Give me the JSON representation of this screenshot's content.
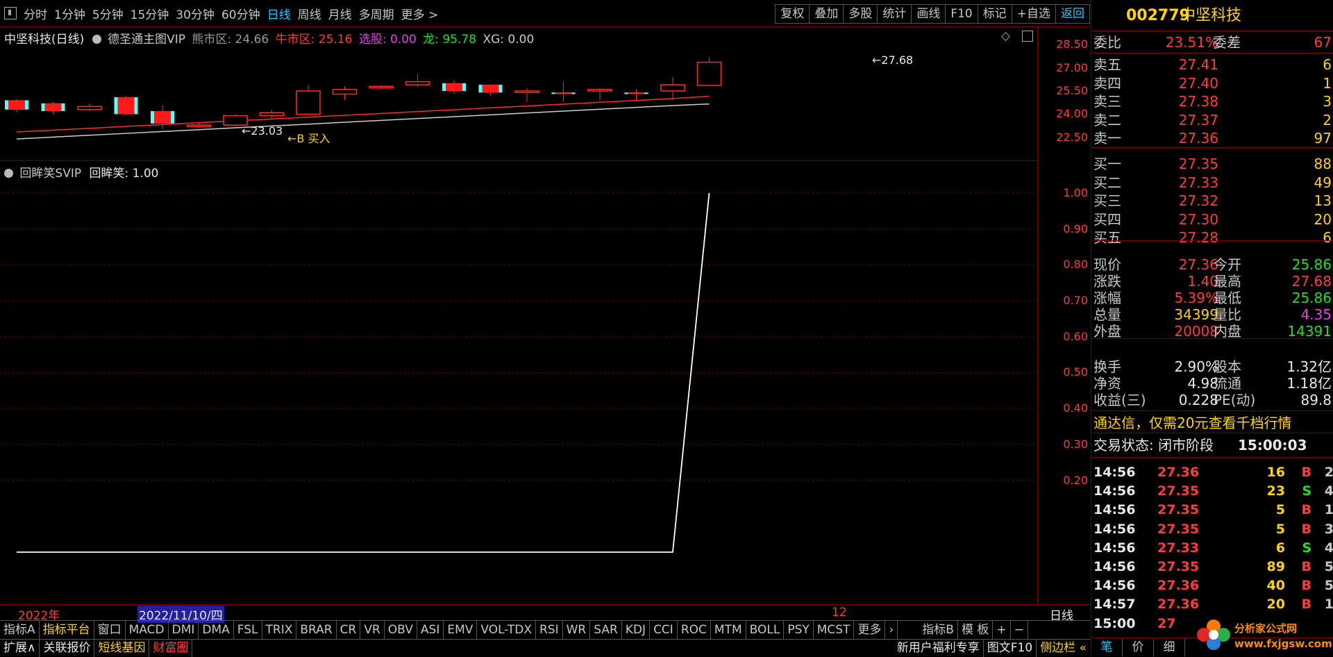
{
  "toolbar": {
    "periods": [
      "分时",
      "1分钟",
      "5分钟",
      "15分钟",
      "30分钟",
      "60分钟",
      "日线",
      "周线",
      "月线",
      "多周期",
      "更多 >"
    ],
    "active_period": "日线",
    "tools": [
      "复权",
      "叠加",
      "多股",
      "统计",
      "画线",
      "F10",
      "标记",
      "+自选",
      "返回"
    ]
  },
  "main_chart": {
    "stock_label": "中坚科技(日线)",
    "indicator_name": "德圣通主图VIP",
    "bear_label": "熊市区:",
    "bear_value": "24.66",
    "bull_label": "牛市区:",
    "bull_value": "25.16",
    "pick_label": "选股:",
    "pick_value": "0.00",
    "dragon_label": "龙:",
    "dragon_value": "95.78",
    "xg_label": "XG:",
    "xg_value": "0.00",
    "high_marker": "←27.68",
    "low_marker": "←23.03",
    "buy_marker": "←B 买入",
    "axis_ticks": [
      "28.50",
      "27.00",
      "25.50",
      "24.00",
      "22.50"
    ]
  },
  "chart_data": [
    {
      "type": "candlestick",
      "title": "中坚科技(日线)",
      "ylim": [
        22.0,
        29.0
      ],
      "candles": [
        {
          "open": 24.9,
          "close": 24.3,
          "high": 25.0,
          "low": 24.1,
          "color": "cyan"
        },
        {
          "open": 24.7,
          "close": 24.2,
          "high": 24.8,
          "low": 24.0,
          "color": "cyan"
        },
        {
          "open": 24.3,
          "close": 24.5,
          "high": 24.7,
          "low": 24.2,
          "color": "red"
        },
        {
          "open": 25.1,
          "close": 24.0,
          "high": 25.2,
          "low": 23.9,
          "color": "cyan"
        },
        {
          "open": 24.2,
          "close": 23.4,
          "high": 24.6,
          "low": 23.03,
          "color": "cyan"
        },
        {
          "open": 23.2,
          "close": 23.3,
          "high": 23.4,
          "low": 23.1,
          "color": "red"
        },
        {
          "open": 23.3,
          "close": 23.9,
          "high": 24.0,
          "low": 23.2,
          "color": "red"
        },
        {
          "open": 23.9,
          "close": 24.1,
          "high": 24.3,
          "low": 23.7,
          "color": "red"
        },
        {
          "open": 24.0,
          "close": 25.5,
          "high": 25.9,
          "low": 23.9,
          "color": "red"
        },
        {
          "open": 25.3,
          "close": 25.6,
          "high": 25.8,
          "low": 24.9,
          "color": "red"
        },
        {
          "open": 25.7,
          "close": 25.8,
          "high": 25.9,
          "low": 25.6,
          "color": "red"
        },
        {
          "open": 25.9,
          "close": 26.1,
          "high": 26.6,
          "low": 25.8,
          "color": "red"
        },
        {
          "open": 26.0,
          "close": 25.5,
          "high": 26.2,
          "low": 25.3,
          "color": "cyan"
        },
        {
          "open": 25.9,
          "close": 25.4,
          "high": 25.9,
          "low": 25.2,
          "color": "cyan"
        },
        {
          "open": 25.4,
          "close": 25.5,
          "high": 25.7,
          "low": 24.8,
          "color": "red"
        },
        {
          "open": 25.4,
          "close": 25.3,
          "high": 26.1,
          "low": 24.8,
          "color": "cyan"
        },
        {
          "open": 25.5,
          "close": 25.6,
          "high": 25.7,
          "low": 24.9,
          "color": "red"
        },
        {
          "open": 25.3,
          "close": 25.4,
          "high": 25.6,
          "low": 24.9,
          "color": "cyan"
        },
        {
          "open": 25.5,
          "close": 25.9,
          "high": 26.4,
          "low": 24.9,
          "color": "red"
        },
        {
          "open": 25.86,
          "close": 27.36,
          "high": 27.68,
          "low": 25.86,
          "color": "red"
        }
      ],
      "series": [
        {
          "values": [
            22.4,
            22.52,
            22.64,
            22.76,
            22.88,
            23.0,
            23.12,
            23.24,
            23.36,
            23.48,
            23.6,
            23.72,
            23.84,
            23.96,
            24.08,
            24.2,
            24.32,
            24.44,
            24.56,
            24.66
          ],
          "color": "white"
        },
        {
          "values": [
            22.85,
            22.97,
            23.09,
            23.21,
            23.33,
            23.45,
            23.57,
            23.69,
            23.81,
            23.93,
            24.05,
            24.17,
            24.29,
            24.41,
            24.53,
            24.65,
            24.77,
            24.89,
            25.01,
            25.16
          ],
          "color": "red"
        }
      ]
    },
    {
      "type": "line",
      "title": "回眸笑SVIP",
      "ylim": [
        0.0,
        1.05
      ],
      "y_ticks": [
        "1.00",
        "0.90",
        "0.80",
        "0.70",
        "0.60",
        "0.50",
        "0.40",
        "0.30",
        "0.20"
      ],
      "series": [
        {
          "name": "回眸笑",
          "values": [
            0,
            0,
            0,
            0,
            0,
            0,
            0,
            0,
            0,
            0,
            0,
            0,
            0,
            0,
            0,
            0,
            0,
            0,
            0,
            1.0
          ]
        }
      ]
    }
  ],
  "sub_chart": {
    "indicator_name": "回眸笑SVIP",
    "value_label": "回眸笑:",
    "value": "1.00"
  },
  "datebar": {
    "year": "2022年",
    "cursor_date": "2022/11/10/四",
    "month": "12",
    "period": "日线"
  },
  "indicator_tabs": [
    "指标A",
    "指标平台",
    "窗口",
    "MACD",
    "DMI",
    "DMA",
    "FSL",
    "TRIX",
    "BRAR",
    "CR",
    "VR",
    "OBV",
    "ASI",
    "EMV",
    "VOL-TDX",
    "RSI",
    "WR",
    "SAR",
    "KDJ",
    "CCI",
    "ROC",
    "MTM",
    "BOLL",
    "PSY",
    "MCST",
    "更多",
    "›",
    "指标B",
    "模 板",
    "+",
    "−"
  ],
  "status_bar": {
    "items": [
      "扩展∧",
      "关联报价",
      "短线基因",
      "财富圈"
    ],
    "right": [
      "新用户福利专享",
      "图文F10",
      "侧边栏 «"
    ]
  },
  "quote": {
    "code": "002779",
    "name": "中坚科技",
    "weibi_label": "委比",
    "weibi": "23.51%",
    "weicha_label": "委差",
    "weicha": "67",
    "asks": [
      {
        "label": "卖五",
        "price": "27.41",
        "vol": "6"
      },
      {
        "label": "卖四",
        "price": "27.40",
        "vol": "1"
      },
      {
        "label": "卖三",
        "price": "27.38",
        "vol": "3"
      },
      {
        "label": "卖二",
        "price": "27.37",
        "vol": "2"
      },
      {
        "label": "卖一",
        "price": "27.36",
        "vol": "97"
      }
    ],
    "bids": [
      {
        "label": "买一",
        "price": "27.35",
        "vol": "88"
      },
      {
        "label": "买二",
        "price": "27.33",
        "vol": "49"
      },
      {
        "label": "买三",
        "price": "27.32",
        "vol": "13"
      },
      {
        "label": "买四",
        "price": "27.30",
        "vol": "20"
      },
      {
        "label": "买五",
        "price": "27.28",
        "vol": "6"
      }
    ],
    "stats": [
      {
        "k1": "现价",
        "v1": "27.36",
        "c1": "red",
        "k2": "今开",
        "v2": "25.86",
        "c2": "green"
      },
      {
        "k1": "涨跌",
        "v1": "1.40",
        "c1": "red",
        "k2": "最高",
        "v2": "27.68",
        "c2": "red"
      },
      {
        "k1": "涨幅",
        "v1": "5.39%",
        "c1": "red",
        "k2": "最低",
        "v2": "25.86",
        "c2": "green"
      },
      {
        "k1": "总量",
        "v1": "34399",
        "c1": "yellow",
        "k2": "量比",
        "v2": "4.35",
        "c2": "mag"
      },
      {
        "k1": "外盘",
        "v1": "20008",
        "c1": "red",
        "k2": "内盘",
        "v2": "14391",
        "c2": "green"
      }
    ],
    "finance": [
      {
        "k1": "换手",
        "v1": "2.90%",
        "k2": "股本",
        "v2": "1.32亿"
      },
      {
        "k1": "净资",
        "v1": "4.98",
        "k2": "流通",
        "v2": "1.18亿"
      },
      {
        "k1": "收益(三)",
        "v1": "0.228",
        "k2": "PE(动)",
        "v2": "89.8"
      }
    ],
    "promo": "通达信，仅需20元查看千档行情",
    "state_label": "交易状态: 闭市阶段",
    "state_time": "15:00:03",
    "ticks": [
      {
        "t": "14:56",
        "p": "27.36",
        "q": "16",
        "d": "B",
        "n": "2"
      },
      {
        "t": "14:56",
        "p": "27.35",
        "q": "23",
        "d": "S",
        "n": "4"
      },
      {
        "t": "14:56",
        "p": "27.35",
        "q": "5",
        "d": "B",
        "n": "1"
      },
      {
        "t": "14:56",
        "p": "27.35",
        "q": "5",
        "d": "B",
        "n": "3"
      },
      {
        "t": "14:56",
        "p": "27.33",
        "q": "6",
        "d": "S",
        "n": "4"
      },
      {
        "t": "14:56",
        "p": "27.35",
        "q": "89",
        "d": "B",
        "n": "5"
      },
      {
        "t": "14:56",
        "p": "27.36",
        "q": "40",
        "d": "B",
        "n": "5"
      },
      {
        "t": "14:57",
        "p": "27.36",
        "q": "20",
        "d": "B",
        "n": "1"
      },
      {
        "t": "15:00",
        "p": "27",
        "q": "",
        "d": "",
        "n": ""
      }
    ],
    "bottom_tabs": [
      "笔",
      "价",
      "细"
    ],
    "watermark": "分析家公式网 www.fxjgsw.com"
  }
}
